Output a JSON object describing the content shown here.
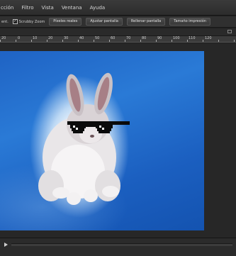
{
  "menubar": {
    "items": [
      "cción",
      "Filtro",
      "Vista",
      "Ventana",
      "Ayuda"
    ]
  },
  "options": {
    "label": "ent.",
    "scrubby_zoom": "Scrubby Zoom",
    "scrubby_checked": true,
    "buttons": [
      "Píxeles reales",
      "Ajustar pantalla",
      "Rellenar pantalla",
      "Tamaño impresión"
    ]
  },
  "ruler": {
    "labels": [
      "20",
      "0",
      "10",
      "20",
      "30",
      "40",
      "50",
      "60",
      "70",
      "80",
      "90",
      "100",
      "110",
      "120"
    ]
  },
  "photo": {
    "subject": "rabbit-with-pixel-sunglasses",
    "background_color": "#1f63c4"
  },
  "icons": {
    "collapse": "collapse-panel-icon",
    "play": "play-icon"
  }
}
